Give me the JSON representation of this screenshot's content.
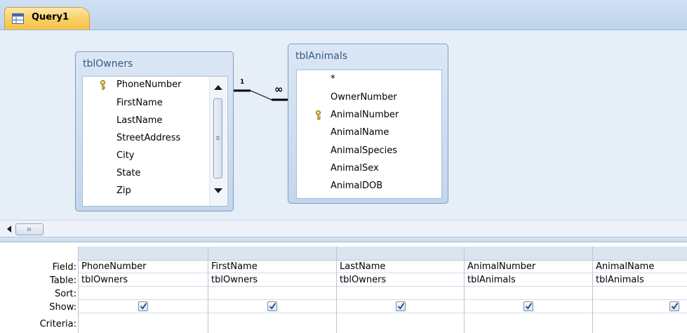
{
  "tab": {
    "label": "Query1"
  },
  "tables": [
    {
      "title": "tblOwners",
      "fields": [
        {
          "name": "PhoneNumber",
          "key": true
        },
        {
          "name": "FirstName",
          "key": false
        },
        {
          "name": "LastName",
          "key": false
        },
        {
          "name": "StreetAddress",
          "key": false
        },
        {
          "name": "City",
          "key": false
        },
        {
          "name": "State",
          "key": false
        },
        {
          "name": "Zip",
          "key": false
        }
      ]
    },
    {
      "title": "tblAnimals",
      "fields": [
        {
          "name": "*",
          "key": false
        },
        {
          "name": "OwnerNumber",
          "key": false
        },
        {
          "name": "AnimalNumber",
          "key": true
        },
        {
          "name": "AnimalName",
          "key": false
        },
        {
          "name": "AnimalSpecies",
          "key": false
        },
        {
          "name": "AnimalSex",
          "key": false
        },
        {
          "name": "AnimalDOB",
          "key": false
        }
      ]
    }
  ],
  "relationship": {
    "one_label": "1",
    "many_label": "∞"
  },
  "grid": {
    "row_labels": [
      "Field:",
      "Table:",
      "Sort:",
      "Show:",
      "Criteria:"
    ],
    "columns": [
      {
        "field": "PhoneNumber",
        "table": "tblOwners",
        "sort": "",
        "show": true
      },
      {
        "field": "FirstName",
        "table": "tblOwners",
        "sort": "",
        "show": true
      },
      {
        "field": "LastName",
        "table": "tblOwners",
        "sort": "",
        "show": true
      },
      {
        "field": "AnimalNumber",
        "table": "tblAnimals",
        "sort": "",
        "show": true
      },
      {
        "field": "AnimalName",
        "table": "tblAnimals",
        "sort": "",
        "show": true
      }
    ]
  },
  "colors": {
    "tab_accent": "#f6c24a",
    "checkmark": "#2b4f8f",
    "title_text": "#39597e"
  }
}
